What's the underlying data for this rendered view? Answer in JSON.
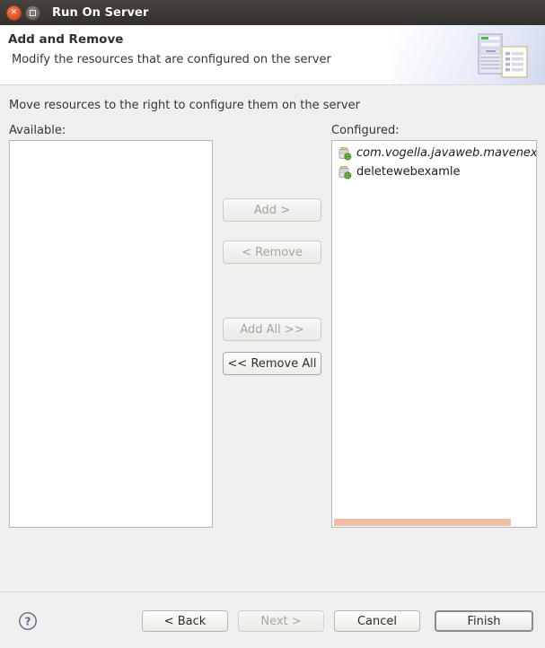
{
  "window": {
    "title": "Run On Server",
    "close_icon": "close-icon",
    "maximize_icon": "maximize-icon"
  },
  "header": {
    "title": "Add and Remove",
    "subtitle": "Modify the resources that are configured on the server",
    "icon": "server-document-icon"
  },
  "main": {
    "instruction": "Move resources to the right to configure them on the server",
    "available": {
      "label": "Available:",
      "items": []
    },
    "configured": {
      "label": "Configured:",
      "items": [
        {
          "label": "com.vogella.javaweb.mavenex",
          "icon": "web-module-icon",
          "italic": true
        },
        {
          "label": "deletewebexamle",
          "icon": "web-module-icon",
          "italic": false
        }
      ],
      "scrollbar": {
        "thumb_percent": 87,
        "color": "#f0bda6"
      }
    },
    "transfer_buttons": [
      {
        "label": "Add >",
        "enabled": false,
        "name": "add-button"
      },
      {
        "label": "< Remove",
        "enabled": false,
        "name": "remove-button"
      },
      {
        "label": "Add All >>",
        "enabled": false,
        "name": "add-all-button"
      },
      {
        "label": "<< Remove All",
        "enabled": true,
        "name": "remove-all-button"
      }
    ]
  },
  "footer": {
    "help_icon": "help-icon",
    "back": "< Back",
    "next": "Next >",
    "cancel": "Cancel",
    "finish": "Finish"
  },
  "colors": {
    "titlebar": "#3c3835",
    "dialog_bg": "#f1efee",
    "accent_close": "#e0572c",
    "scrollbar_thumb": "#f0bda6"
  }
}
